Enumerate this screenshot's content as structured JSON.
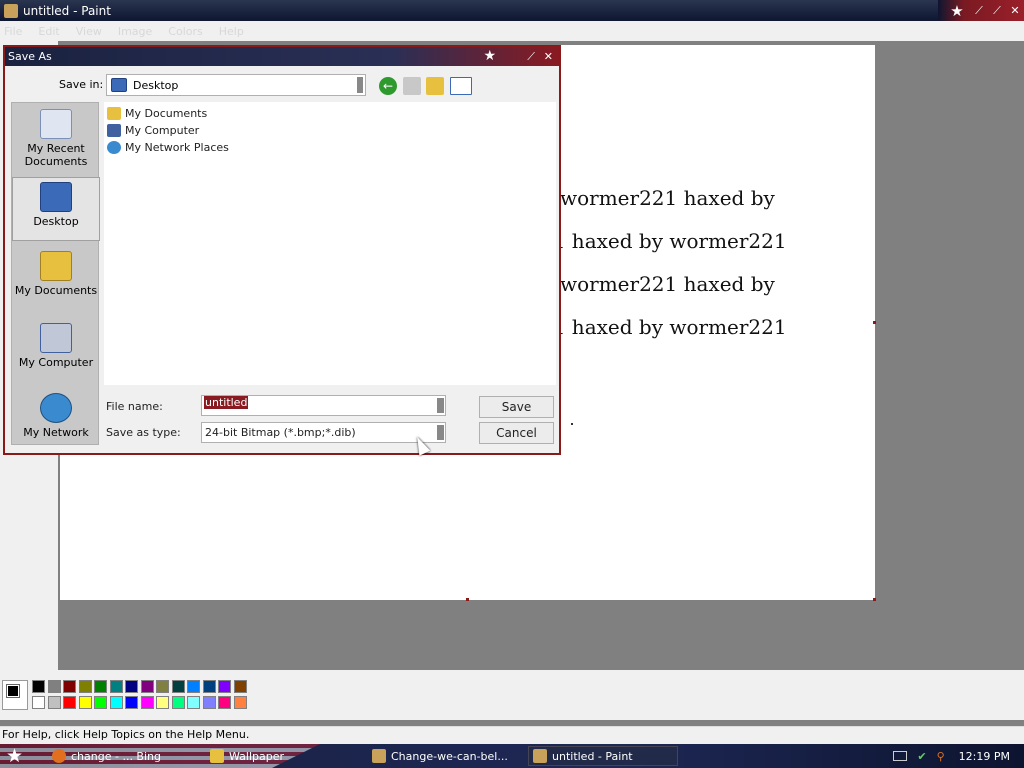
{
  "window": {
    "title": "untitled - Paint",
    "menu": [
      "File",
      "Edit",
      "View",
      "Image",
      "Colors",
      "Help"
    ]
  },
  "canvas": {
    "lines": [
      "wormer221 haxed by",
      "21 haxed by wormer221",
      "wormer221 haxed by",
      "21 haxed by wormer221"
    ]
  },
  "palette": {
    "top_row": [
      "#000000",
      "#808080",
      "#800000",
      "#808000",
      "#008000",
      "#008080",
      "#000080",
      "#800080",
      "#808040",
      "#004040",
      "#0080ff",
      "#004080",
      "#8000ff",
      "#804000"
    ],
    "bottom_row": [
      "#ffffff",
      "#c0c0c0",
      "#ff0000",
      "#ffff00",
      "#00ff00",
      "#00ffff",
      "#0000ff",
      "#ff00ff",
      "#ffff80",
      "#00ff80",
      "#80ffff",
      "#8080ff",
      "#ff0080",
      "#ff8040"
    ],
    "foreground": "#000000",
    "background": "#ffffff"
  },
  "status": "For Help, click Help Topics on the Help Menu.",
  "dialog": {
    "title": "Save As",
    "save_in_label": "Save in:",
    "save_in_value": "Desktop",
    "places": [
      "My Recent Documents",
      "Desktop",
      "My Documents",
      "My Computer",
      "My Network"
    ],
    "selected_place": "Desktop",
    "files": [
      "My Documents",
      "My Computer",
      "My Network Places"
    ],
    "file_name_label": "File name:",
    "file_name_value": "untitled",
    "save_as_type_label": "Save as type:",
    "save_as_type_value": "24-bit Bitmap (*.bmp;*.dib)",
    "save_button": "Save",
    "cancel_button": "Cancel"
  },
  "taskbar": {
    "tasks": [
      "change - ... Bing",
      "Wallpaper",
      "Change-we-can-bel...",
      "untitled - Paint"
    ],
    "clock": "12:19 PM"
  }
}
